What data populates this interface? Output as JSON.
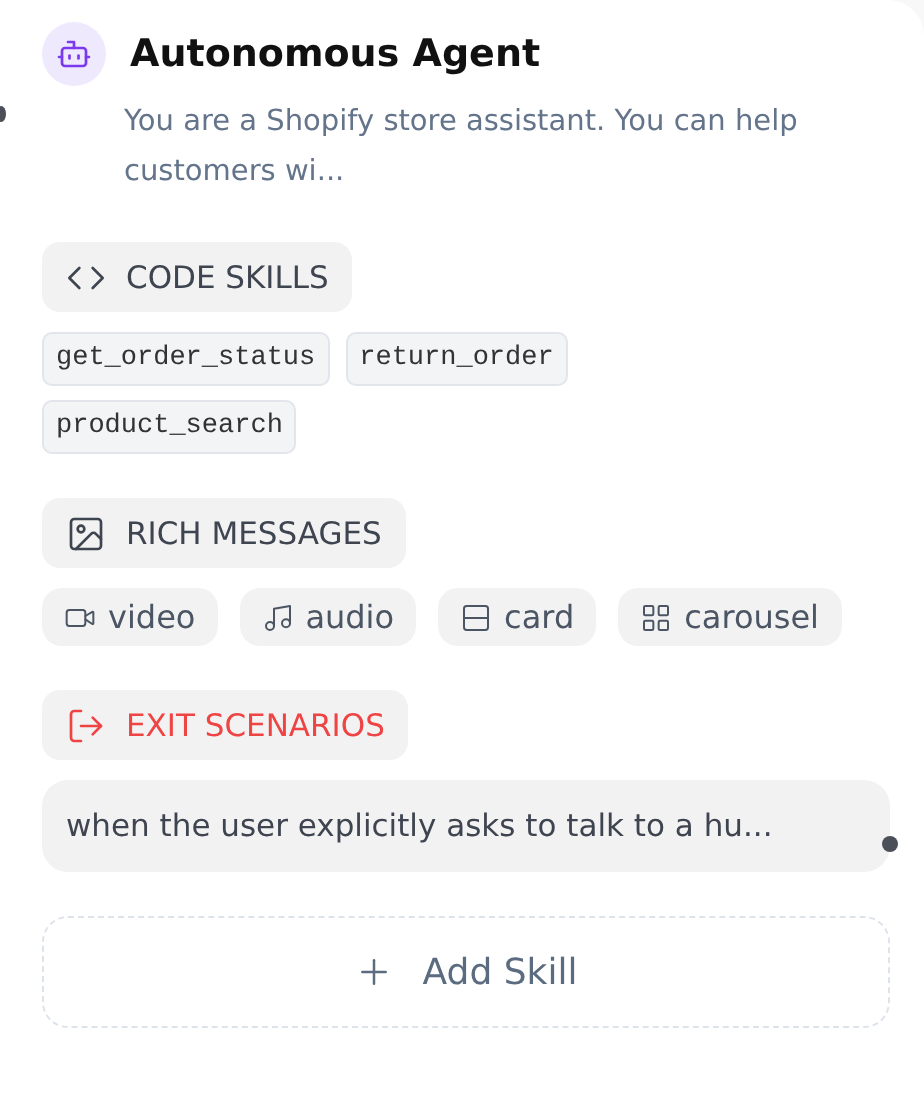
{
  "node": {
    "title": "Autonomous Agent",
    "description": "You are a Shopify store assistant. You can help customers wi..."
  },
  "sections": [
    {
      "kind": "code",
      "title": "CODE SKILLS",
      "items": [
        {
          "label": "get_order_status"
        },
        {
          "label": "return_order"
        },
        {
          "label": "product_search"
        }
      ]
    },
    {
      "kind": "rich",
      "title": "RICH MESSAGES",
      "items": [
        {
          "label": "video",
          "kind": "video"
        },
        {
          "label": "audio",
          "kind": "audio"
        },
        {
          "label": "card",
          "kind": "card"
        },
        {
          "label": "carousel",
          "kind": "carousel"
        }
      ]
    },
    {
      "kind": "exit",
      "title": "EXIT SCENARIOS",
      "items": [
        {
          "label": "when the user explicitly asks to talk to a hu..."
        }
      ]
    }
  ],
  "add_button": {
    "label": "Add Skill"
  }
}
